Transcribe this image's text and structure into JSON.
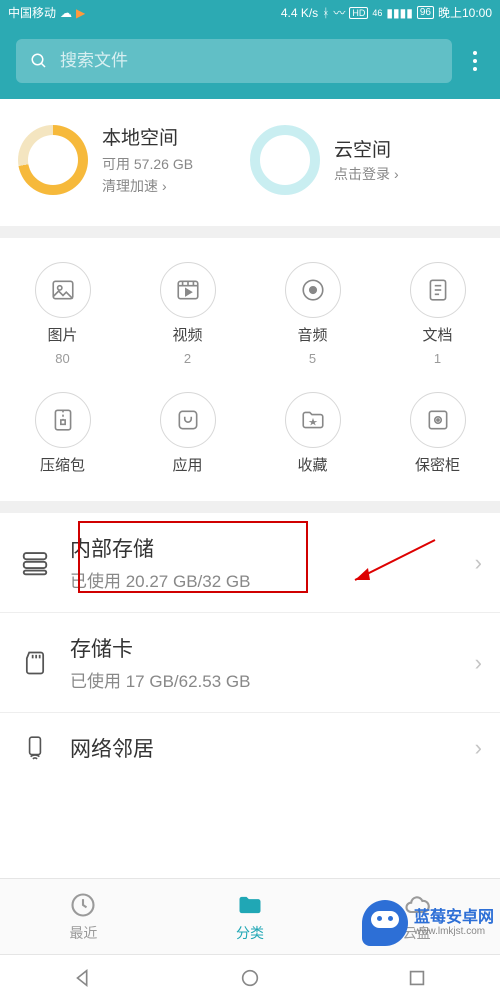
{
  "status": {
    "carrier": "中国移动",
    "net_speed": "4.4 K/s",
    "battery": "96",
    "time": "晚上10:00"
  },
  "search": {
    "placeholder": "搜索文件"
  },
  "storage": {
    "local": {
      "title": "本地空间",
      "free": "可用 57.26 GB",
      "link": "清理加速"
    },
    "cloud": {
      "title": "云空间",
      "link": "点击登录"
    }
  },
  "categories": [
    {
      "label": "图片",
      "count": "80",
      "icon": "image"
    },
    {
      "label": "视频",
      "count": "2",
      "icon": "video"
    },
    {
      "label": "音频",
      "count": "5",
      "icon": "audio"
    },
    {
      "label": "文档",
      "count": "1",
      "icon": "doc"
    },
    {
      "label": "压缩包",
      "count": "",
      "icon": "zip"
    },
    {
      "label": "应用",
      "count": "",
      "icon": "app"
    },
    {
      "label": "收藏",
      "count": "",
      "icon": "fav"
    },
    {
      "label": "保密柜",
      "count": "",
      "icon": "safe"
    }
  ],
  "list": {
    "internal": {
      "title": "内部存储",
      "sub": "已使用 20.27 GB/32 GB"
    },
    "sdcard": {
      "title": "存储卡",
      "sub": "已使用 17 GB/62.53 GB"
    },
    "network": {
      "title": "网络邻居"
    }
  },
  "tabs": {
    "recent": "最近",
    "category": "分类",
    "cloud": "云盘"
  },
  "watermark": {
    "name": "蓝莓安卓网",
    "url": "www.lmkjst.com"
  },
  "chevron": "›"
}
